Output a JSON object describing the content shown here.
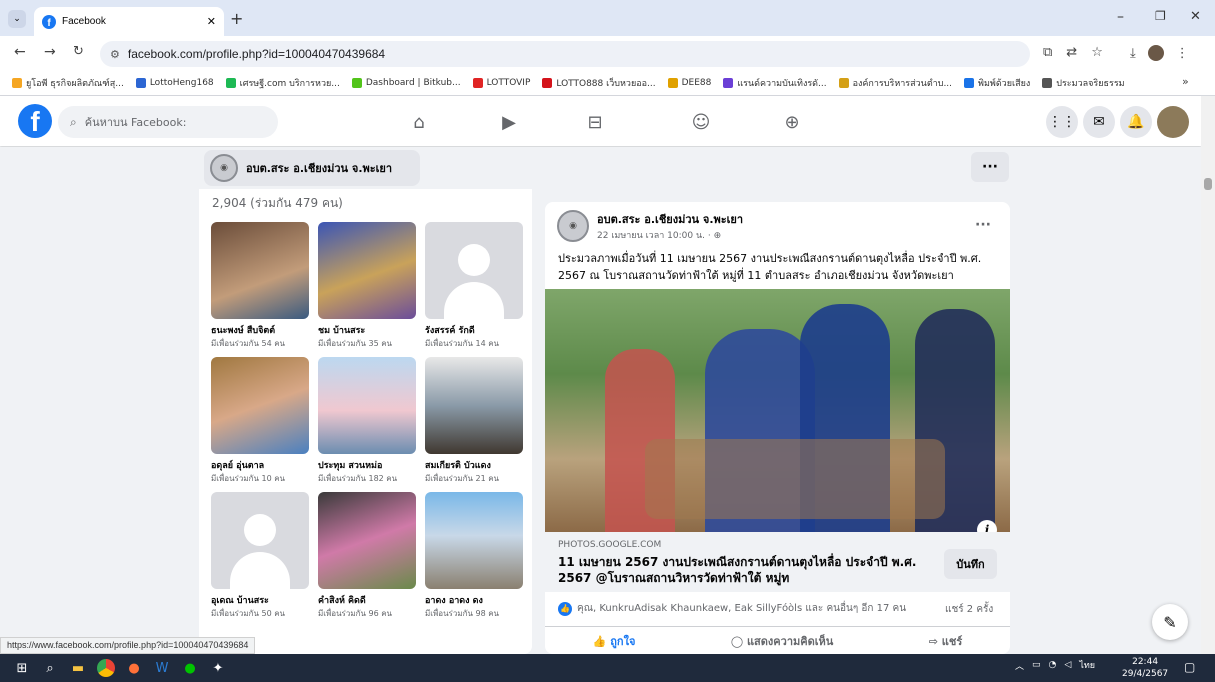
{
  "browser": {
    "tab_title": "Facebook",
    "url": "facebook.com/profile.php?id=100040470439684",
    "status_url": "https://www.facebook.com/profile.php?id=100040470439684",
    "bookmarks": [
      {
        "label": "ยูโอพี ธุรกิจผลิตภัณฑ์สุ...",
        "color": "#f5a623"
      },
      {
        "label": "LottoHeng168",
        "color": "#2c66d3"
      },
      {
        "label": "เศรษฐี.com บริการหวย...",
        "color": "#1db954"
      },
      {
        "label": "Dashboard | Bitkub...",
        "color": "#52c41a"
      },
      {
        "label": "LOTTOVIP",
        "color": "#e02424"
      },
      {
        "label": "LOTTO888 เว็บหวยออ...",
        "color": "#d4131b"
      },
      {
        "label": "DEE88",
        "color": "#e0a100"
      },
      {
        "label": "แรนด์ความบันเทิงรดั...",
        "color": "#6b3fd6"
      },
      {
        "label": "องค์การบริหารส่วนตำบ...",
        "color": "#d4a017"
      },
      {
        "label": "พิมพ์ด้วยเสียง",
        "color": "#1a73e8"
      },
      {
        "label": "ประมวลจริยธรรม",
        "color": "#555555"
      }
    ],
    "more_bookmarks": "»"
  },
  "facebook": {
    "search_placeholder": "ค้นหาบน Facebook:",
    "page_name": "อบต.สระ อ.เชียงม่วน จ.พะเยา"
  },
  "friends": {
    "count_text": "2,904 (ร่วมกัน 479 คน)",
    "items": [
      {
        "name": "ธนะพงษ์ สืบจิตต์",
        "mutual": "มีเพื่อนร่วมกัน 54 คน"
      },
      {
        "name": "ชม บ้านสระ",
        "mutual": "มีเพื่อนร่วมกัน 35 คน"
      },
      {
        "name": "รังสรรค์ รักดี",
        "mutual": "มีเพื่อนร่วมกัน 14 คน"
      },
      {
        "name": "อดุลย์ อุ่นตาล",
        "mutual": "มีเพื่อนร่วมกัน 10 คน"
      },
      {
        "name": "ประทุม สวนหม่อ",
        "mutual": "มีเพื่อนร่วมกัน 182 คน"
      },
      {
        "name": "สมเกียรติ บัวแดง",
        "mutual": "มีเพื่อนร่วมกัน 21 คน"
      },
      {
        "name": "อุเดณ บ้านสระ",
        "mutual": "มีเพื่อนร่วมกัน 50 คน"
      },
      {
        "name": "คำสิงห์ คิดดี",
        "mutual": "มีเพื่อนร่วมกัน 96 คน"
      },
      {
        "name": "อาดง อาดง ดง",
        "mutual": "มีเพื่อนร่วมกัน 98 คน"
      }
    ]
  },
  "post": {
    "author": "อบต.สระ อ.เชียงม่วน จ.พะเยา",
    "time": "22 เมษายน เวลา 10:00 น. · ",
    "text": "ประมวลภาพเมื่อวันที่ 11 เมษายน 2567 งานประเพณีสงกรานต์ดานตุงไหลื่อ ประจำปี พ.ศ. 2567 ณ โบราณสถานวัดท่าฟ้าใต้ หมู่ที่ 11 ตำบลสระ อำเภอเชียงม่วน จังหวัดพะเยา",
    "link_source": "PHOTOS.GOOGLE.COM",
    "link_title": "11 เมษายน 2567 งานประเพณีสงกรานต์ดานตุงไหลื่อ ประจำปี พ.ศ. 2567 @โบราณสถานวิหารวัดท่าฟ้าใต้ หมู่ท",
    "save_label": "บันทึก",
    "reactions_text": "คุณ, KunkruAdisak Khaunkaew, Eak SillyFóòls และ คนอื่นๆ อีก 17 คน",
    "shares_text": "แชร์ 2 ครั้ง",
    "like_label": "ถูกใจ",
    "comment_label": "แสดงความคิดเห็น",
    "share_label": "แชร์"
  },
  "taskbar": {
    "lang": "ไทย",
    "time": "22:44",
    "date": "29/4/2567"
  }
}
